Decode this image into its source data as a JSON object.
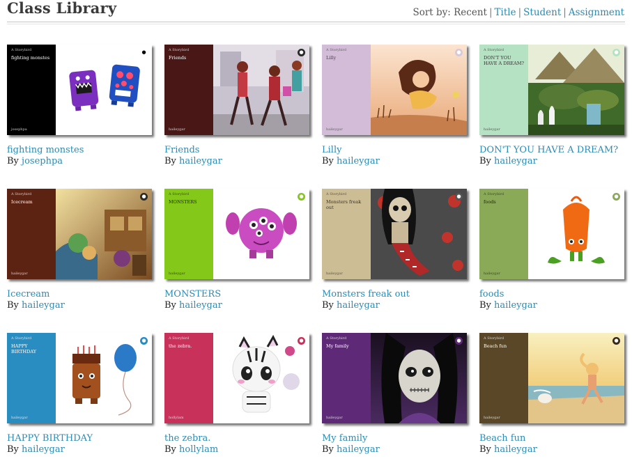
{
  "header": {
    "title": "Class Library",
    "sort_label": "Sort by:",
    "sort_options": [
      "Recent",
      "Title",
      "Student",
      "Assignment"
    ]
  },
  "by_label": "By",
  "cover_kind": "A Storybird",
  "books": [
    {
      "title": "fighting monstes",
      "author": "josephpa",
      "spine_color": "#000000",
      "spine_text": "#ffffff",
      "badge_color": "#ffffff",
      "badge_fg": "#000000"
    },
    {
      "title": "Friends",
      "author": "haileygar",
      "spine_color": "#4a1717",
      "spine_text": "#ffffff",
      "badge_color": "#2a2a2a",
      "badge_fg": "#ffffff"
    },
    {
      "title": "Lilly",
      "author": "haileygar",
      "spine_color": "#d3bcd8",
      "spine_text": "#444444",
      "badge_color": "#d9c8da",
      "badge_fg": "#ffffff"
    },
    {
      "title": "DON'T YOU HAVE A DREAM?",
      "author": "haileygar",
      "spine_color": "#b5e2c2",
      "spine_text": "#333333",
      "badge_color": "#b5e2c2",
      "badge_fg": "#ffffff"
    },
    {
      "title": "Icecream",
      "author": "haileygar",
      "spine_color": "#5c2212",
      "spine_text": "#ffffff",
      "badge_color": "#2a2a2a",
      "badge_fg": "#ffffff"
    },
    {
      "title": "MONSTERS",
      "author": "haileygar",
      "spine_color": "#84c81a",
      "spine_text": "#222222",
      "badge_color": "#84c81a",
      "badge_fg": "#ffffff"
    },
    {
      "title": "Monsters freak out",
      "author": "haileygar",
      "spine_color": "#cdbd94",
      "spine_text": "#333333",
      "badge_color": "#555555",
      "badge_fg": "#ffffff"
    },
    {
      "title": "foods",
      "author": "haileygar",
      "spine_color": "#8aaa58",
      "spine_text": "#222222",
      "badge_color": "#8aaa58",
      "badge_fg": "#ffffff"
    },
    {
      "title": "HAPPY BIRTHDAY",
      "author": "haileygar",
      "spine_color": "#2a8dc2",
      "spine_text": "#ffffff",
      "badge_color": "#2a8dc2",
      "badge_fg": "#ffffff"
    },
    {
      "title": "the zebra.",
      "author": "hollylam",
      "spine_color": "#c7315a",
      "spine_text": "#ffffff",
      "badge_color": "#c7315a",
      "badge_fg": "#ffffff"
    },
    {
      "title": "My family",
      "author": "haileygar",
      "spine_color": "#5e2a77",
      "spine_text": "#ffffff",
      "badge_color": "#5e2a77",
      "badge_fg": "#ffffff"
    },
    {
      "title": "Beach fun",
      "author": "haileygar",
      "spine_color": "#5a4728",
      "spine_text": "#ffffff",
      "badge_color": "#3a2a18",
      "badge_fg": "#ffffff"
    }
  ]
}
